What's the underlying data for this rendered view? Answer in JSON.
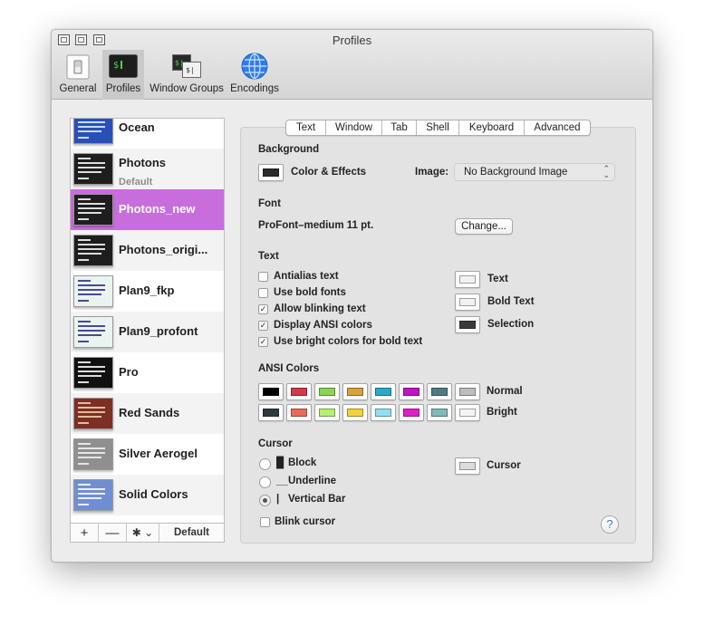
{
  "window": {
    "title": "Profiles"
  },
  "toolbar": {
    "items": [
      {
        "label": "General",
        "icon": "general-switch-icon"
      },
      {
        "label": "Profiles",
        "icon": "terminal-icon",
        "active": true
      },
      {
        "label": "Window Groups",
        "icon": "window-groups-icon"
      },
      {
        "label": "Encodings",
        "icon": "globe-icon"
      }
    ]
  },
  "sidebar": {
    "profiles": [
      {
        "name": "Ocean",
        "subtitle": "",
        "bg": "#2950b8",
        "fg": "#e8f0ff"
      },
      {
        "name": "Photons",
        "subtitle": "Default",
        "bg": "#1e1e1e",
        "fg": "#ffffff"
      },
      {
        "name": "Photons_new",
        "subtitle": "",
        "bg": "#1e1e1e",
        "fg": "#ffffff",
        "selected": true
      },
      {
        "name": "Photons_origi...",
        "subtitle": "",
        "bg": "#1e1e1e",
        "fg": "#ffffff"
      },
      {
        "name": "Plan9_fkp",
        "subtitle": "",
        "bg": "#e9f4ee",
        "fg": "#2a2a8a"
      },
      {
        "name": "Plan9_profont",
        "subtitle": "",
        "bg": "#e9f4ee",
        "fg": "#2a2a8a"
      },
      {
        "name": "Pro",
        "subtitle": "",
        "bg": "#111111",
        "fg": "#ffffff"
      },
      {
        "name": "Red Sands",
        "subtitle": "",
        "bg": "#7d2f25",
        "fg": "#f3d6b0"
      },
      {
        "name": "Silver Aerogel",
        "subtitle": "",
        "bg": "#8f8f8f",
        "fg": "#f5f5f5"
      },
      {
        "name": "Solid Colors",
        "subtitle": "",
        "bg": "#6f8fd0",
        "fg": "#ffffff"
      }
    ],
    "footer": {
      "add": "+",
      "remove": "—",
      "gear": "✱ ⌄",
      "default": "Default"
    }
  },
  "tabs": [
    {
      "label": "Text",
      "active": true
    },
    {
      "label": "Window"
    },
    {
      "label": "Tab"
    },
    {
      "label": "Shell"
    },
    {
      "label": "Keyboard"
    },
    {
      "label": "Advanced"
    }
  ],
  "background": {
    "section": "Background",
    "color_effects_label": "Color & Effects",
    "color": "#2b2b2b",
    "image_label": "Image:",
    "image_value": "No Background Image"
  },
  "font": {
    "section": "Font",
    "value": "ProFont–medium 11 pt.",
    "change_button": "Change..."
  },
  "text": {
    "section": "Text",
    "options": [
      {
        "label": "Antialias text",
        "checked": false
      },
      {
        "label": "Use bold fonts",
        "checked": false
      },
      {
        "label": "Allow blinking text",
        "checked": true
      },
      {
        "label": "Display ANSI colors",
        "checked": true
      },
      {
        "label": "Use bright colors for bold text",
        "checked": true
      }
    ],
    "colors": [
      {
        "label": "Text",
        "color": "#f2f2f2"
      },
      {
        "label": "Bold Text",
        "color": "#f2f2f2"
      },
      {
        "label": "Selection",
        "color": "#3a3a3a"
      }
    ]
  },
  "ansi": {
    "section": "ANSI Colors",
    "normal_label": "Normal",
    "bright_label": "Bright",
    "normal": [
      "#000000",
      "#d03a4a",
      "#8bd44e",
      "#dca13a",
      "#2aa9c9",
      "#c014c4",
      "#4e7c82",
      "#bdbdbd"
    ],
    "bright": [
      "#2f3a3e",
      "#ec6a5a",
      "#b7ef72",
      "#f5d23a",
      "#8fe0f2",
      "#e01ec8",
      "#82b8b8",
      "#f4f4f4"
    ]
  },
  "cursor": {
    "section": "Cursor",
    "shapes": [
      {
        "glyph": "█",
        "label": "Block",
        "selected": false
      },
      {
        "glyph": "__",
        "label": "Underline",
        "selected": false
      },
      {
        "glyph": "|",
        "label": "Vertical Bar",
        "selected": true
      }
    ],
    "blink_label": "Blink cursor",
    "blink_checked": false,
    "color_label": "Cursor",
    "color": "#dcdcdc"
  },
  "help": "?"
}
